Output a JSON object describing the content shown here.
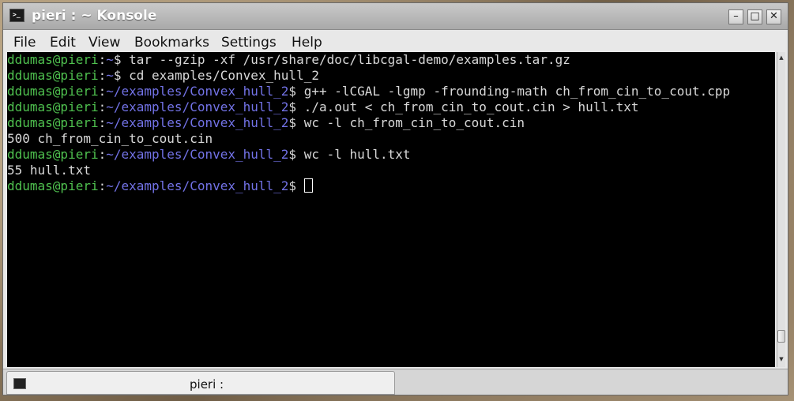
{
  "window": {
    "title": "pieri : ~ Konsole",
    "title_icon_glyph": ">_",
    "buttons": {
      "minimize": "–",
      "maximize": "□",
      "close": "✕"
    }
  },
  "menubar": {
    "items": [
      "File",
      "Edit",
      "View",
      "Bookmarks",
      "Settings",
      "Help"
    ]
  },
  "terminal": {
    "colors": {
      "user": "#4fc14f",
      "path": "#7272e6",
      "text": "#d8d8d8",
      "background": "#000000"
    },
    "lines": [
      {
        "kind": "prompt",
        "user": "ddumas@pieri",
        "sep": ":",
        "path": "~",
        "end": "$ ",
        "cmd": "tar --gzip -xf /usr/share/doc/libcgal-demo/examples.tar.gz"
      },
      {
        "kind": "prompt",
        "user": "ddumas@pieri",
        "sep": ":",
        "path": "~",
        "end": "$ ",
        "cmd": "cd examples/Convex_hull_2"
      },
      {
        "kind": "prompt",
        "user": "ddumas@pieri",
        "sep": ":",
        "path": "~/examples/Convex_hull_2",
        "end": "$ ",
        "cmd": "g++ -lCGAL -lgmp -frounding-math ch_from_cin_to_cout.cpp"
      },
      {
        "kind": "prompt",
        "user": "ddumas@pieri",
        "sep": ":",
        "path": "~/examples/Convex_hull_2",
        "end": "$ ",
        "cmd": "./a.out < ch_from_cin_to_cout.cin > hull.txt"
      },
      {
        "kind": "prompt",
        "user": "ddumas@pieri",
        "sep": ":",
        "path": "~/examples/Convex_hull_2",
        "end": "$ ",
        "cmd": "wc -l ch_from_cin_to_cout.cin"
      },
      {
        "kind": "output",
        "text": "500 ch_from_cin_to_cout.cin"
      },
      {
        "kind": "prompt",
        "user": "ddumas@pieri",
        "sep": ":",
        "path": "~/examples/Convex_hull_2",
        "end": "$ ",
        "cmd": "wc -l hull.txt"
      },
      {
        "kind": "output",
        "text": "55 hull.txt"
      },
      {
        "kind": "prompt",
        "user": "ddumas@pieri",
        "sep": ":",
        "path": "~/examples/Convex_hull_2",
        "end": "$ ",
        "cmd": "",
        "cursor": true
      }
    ]
  },
  "tabbar": {
    "tabs": [
      {
        "label": "pieri :",
        "icon": "terminal-icon"
      }
    ]
  }
}
